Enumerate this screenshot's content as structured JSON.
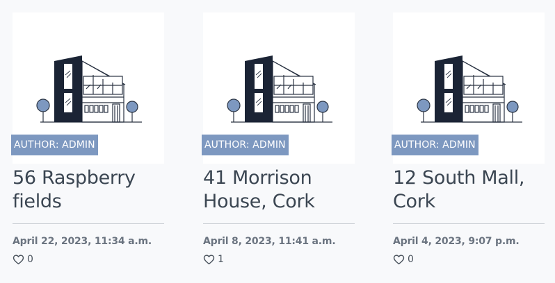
{
  "listings": [
    {
      "author_badge": "AUTHOR: ADMIN",
      "title": "56 Raspberry fields",
      "date": "April 22, 2023, 11:34 a.m.",
      "likes": "0",
      "image_icon": "house-illustration-icon",
      "like_icon": "heart-outline-icon"
    },
    {
      "author_badge": "AUTHOR: ADMIN",
      "title": "41 Morrison House, Cork",
      "date": "April 8, 2023, 11:41 a.m.",
      "likes": "1",
      "image_icon": "house-illustration-icon",
      "like_icon": "heart-outline-icon"
    },
    {
      "author_badge": "AUTHOR: ADMIN",
      "title": "12 South Mall, Cork",
      "date": "April 4, 2023, 9:07 p.m.",
      "likes": "0",
      "image_icon": "house-illustration-icon",
      "like_icon": "heart-outline-icon"
    }
  ],
  "colors": {
    "badge_bg": "#7d98c0",
    "title_text": "#3b4652",
    "date_text": "#6b7480",
    "house_dark": "#1b2435",
    "tree_fill": "#7d98c0"
  }
}
